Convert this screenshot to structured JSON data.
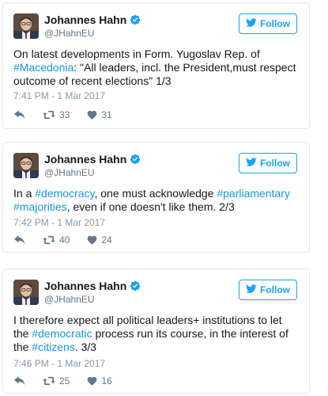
{
  "follow_label": "Follow",
  "tweets": [
    {
      "name": "Johannes Hahn",
      "handle": "@JHahnEU",
      "text_parts": [
        {
          "t": "On latest developments in Form. Yugoslav Rep. of ",
          "tag": false
        },
        {
          "t": "#Macedonia",
          "tag": true
        },
        {
          "t": ": \"All leaders, incl. the President,must respect outcome of recent elections\" 1/3",
          "tag": false
        }
      ],
      "timestamp": "7:41 PM - 1 Mar 2017",
      "retweets": "33",
      "likes": "31"
    },
    {
      "name": "Johannes Hahn",
      "handle": "@JHahnEU",
      "text_parts": [
        {
          "t": "In a ",
          "tag": false
        },
        {
          "t": "#democracy",
          "tag": true
        },
        {
          "t": ", one must acknowledge ",
          "tag": false
        },
        {
          "t": "#parliamentary",
          "tag": true
        },
        {
          "t": " ",
          "tag": false
        },
        {
          "t": "#majorities",
          "tag": true
        },
        {
          "t": ", even if one doesn't like them. 2/3",
          "tag": false
        }
      ],
      "timestamp": "7:42 PM - 1 Mar 2017",
      "retweets": "40",
      "likes": "24"
    },
    {
      "name": "Johannes Hahn",
      "handle": "@JHahnEU",
      "text_parts": [
        {
          "t": "I therefore expect all political leaders+ institutions to let the ",
          "tag": false
        },
        {
          "t": "#democratic",
          "tag": true
        },
        {
          "t": " process run its course, in the interest of the ",
          "tag": false
        },
        {
          "t": "#citizens",
          "tag": true
        },
        {
          "t": ". 3/3",
          "tag": false
        }
      ],
      "timestamp": "7:46 PM - 1 Mar 2017",
      "retweets": "25",
      "likes": "16"
    }
  ],
  "icons": {
    "avatar": "profile-photo",
    "verified": "verified-badge-icon",
    "follow": "bird-icon",
    "reply": "reply-icon",
    "retweet": "retweet-icon",
    "like": "heart-icon"
  },
  "colors": {
    "accent": "#1da1f2",
    "hashtag": "#1b95e0",
    "muted": "#657786",
    "timestamp": "#8899a6",
    "border": "#e1e8ed"
  }
}
